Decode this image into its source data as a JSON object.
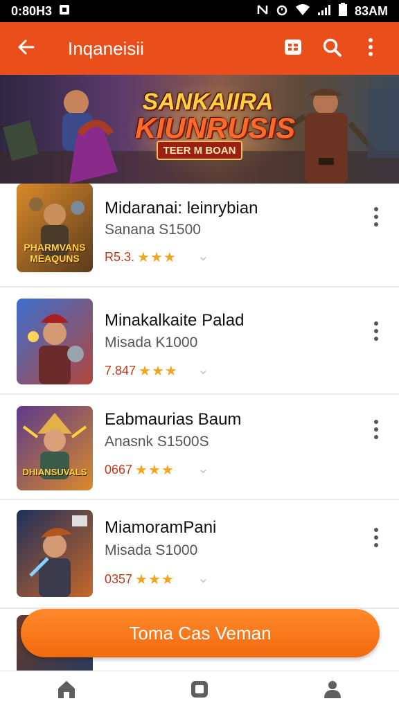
{
  "status_bar": {
    "time": "0:80H3",
    "battery_text": "83AM"
  },
  "app_bar": {
    "title": "Inqaneisii",
    "back_icon": "arrow-left-icon",
    "actions": [
      "grid-icon",
      "search-icon",
      "more-vert-icon"
    ]
  },
  "banner": {
    "title_line1": "SANKAIIRA",
    "title_line2": "KIUNRUSIS",
    "button_label": "TEER M BOAN"
  },
  "games": [
    {
      "name": "Midaranai: leinrybian",
      "subtitle": "Sanana S1500",
      "rating": "R5.3.",
      "stars": "★★★",
      "thumb_text": "PHARMVANS MEAQUNS",
      "thumb_colors": [
        "#d98a2b",
        "#5a3a1c"
      ]
    },
    {
      "name": "Minakalkaite Palad",
      "subtitle": "Misada K1000",
      "rating": "7.847",
      "stars": "★★★",
      "thumb_text": "",
      "thumb_colors": [
        "#3d6fd0",
        "#b2453a"
      ]
    },
    {
      "name": "Eabmaurias Baum",
      "subtitle": "Anasnk S1500S",
      "rating": "0667",
      "stars": "★★★",
      "thumb_text": "DHIANSUVALS",
      "thumb_colors": [
        "#5c3a8a",
        "#d98a2b"
      ]
    },
    {
      "name": "MiamoramPani",
      "subtitle": "Misada S1000",
      "rating": "0357",
      "stars": "★★★",
      "thumb_text": "",
      "thumb_colors": [
        "#1e2f5a",
        "#c7682a"
      ]
    }
  ],
  "cta": {
    "label": "Toma Cas Veman"
  },
  "bottom_nav": [
    "home-icon",
    "square-icon",
    "person-icon"
  ],
  "colors": {
    "primary": "#e94e1b",
    "cta": "#f57c1f",
    "star": "#f2a51e",
    "rating": "#c0391b"
  }
}
